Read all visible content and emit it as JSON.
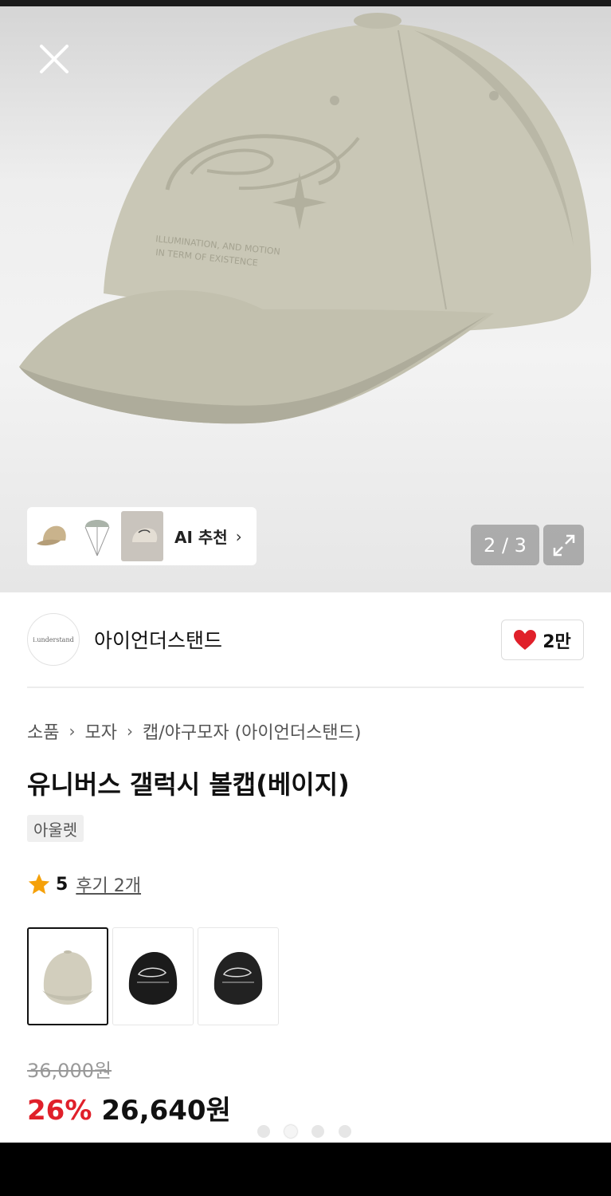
{
  "hero": {
    "counter": "2 / 3",
    "ai_recommend_label": "AI 추천",
    "ai_recommend_chevron": "›",
    "thumbnails": [
      "beige-cap-thumb",
      "parachute-thumb",
      "cap-closeup-thumb"
    ]
  },
  "brand": {
    "name": "아이언더스탠드",
    "logo_text": "i.understand",
    "likes": "2만"
  },
  "breadcrumb": {
    "items": [
      "소품",
      "모자",
      "캡/야구모자 (아이언더스탠드)"
    ],
    "separator": "›"
  },
  "product": {
    "title": "유니버스 갤럭시 볼캡(베이지)",
    "badge": "아울렛",
    "rating": "5",
    "reviews": "후기 2개",
    "swatches": [
      "beige",
      "black",
      "black"
    ],
    "original_price": "36,000원",
    "discount": "26%",
    "sale_price": "26,640원"
  },
  "carousel": {
    "dots": 4,
    "active": 2
  },
  "colors": {
    "cap_beige": "#c8c6b6",
    "accent_red": "#e0202a",
    "star": "#f5a10a"
  }
}
